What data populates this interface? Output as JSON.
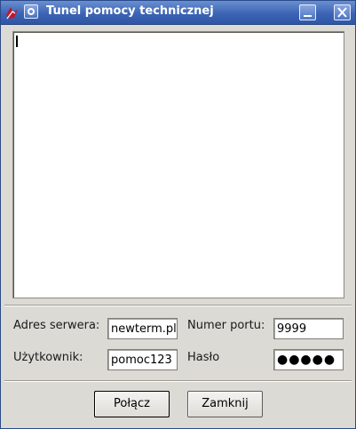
{
  "window": {
    "title": "Tunel pomocy technicznej",
    "icons": {
      "app": "app-logo-icon",
      "menu": "window-menu-icon",
      "minimize": "minimize-icon",
      "close": "close-icon"
    }
  },
  "log": {
    "text": ""
  },
  "form": {
    "server_label": "Adres serwera:",
    "server_value": "newterm.pl",
    "port_label": "Numer portu:",
    "port_value": "9999",
    "user_label": "Użytkownik:",
    "user_value": "pomoc123",
    "password_label": "Hasło",
    "password_mask": "●●●●●"
  },
  "buttons": {
    "connect": "Połącz",
    "close": "Zamknij"
  },
  "colors": {
    "titlebar": "#3c64b4",
    "window_bg": "#dcdad5"
  }
}
